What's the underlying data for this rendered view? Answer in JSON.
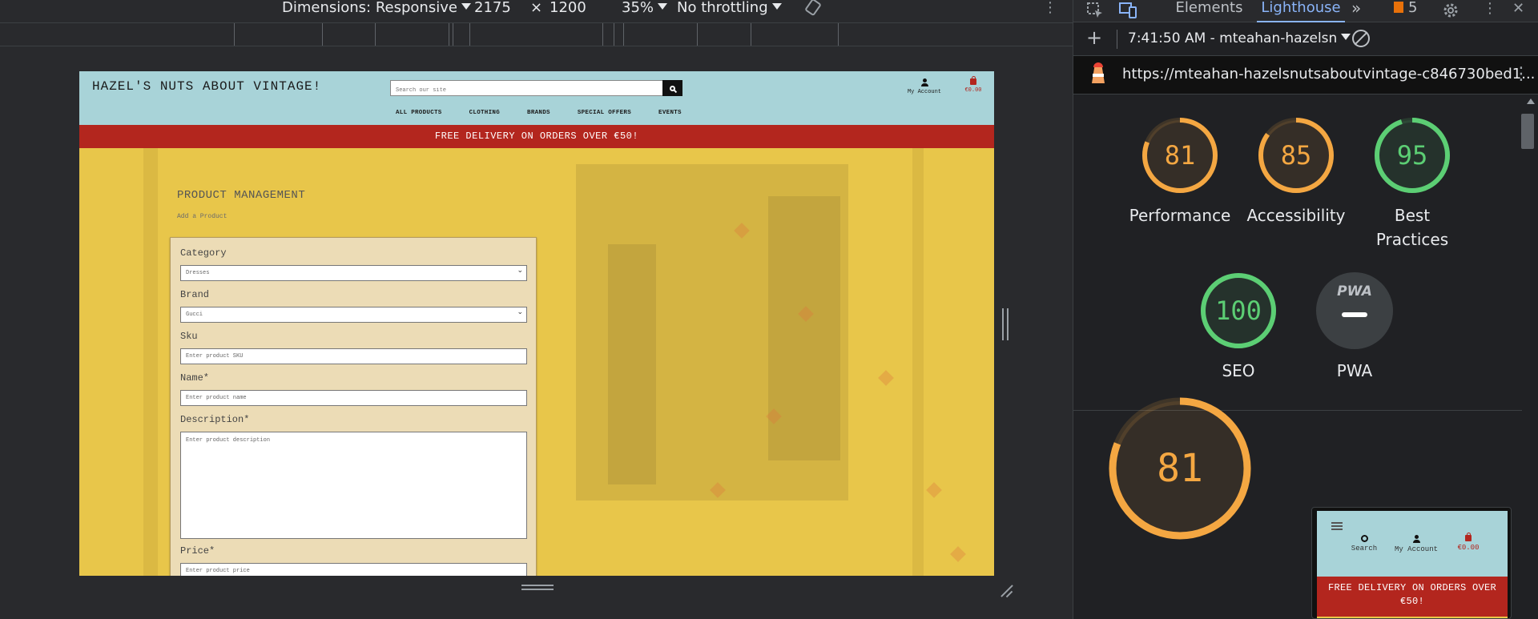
{
  "emulation_toolbar": {
    "dimensions_label": "Dimensions: Responsive",
    "width": "2175",
    "times": "×",
    "height": "1200",
    "zoom": "35%",
    "throttling": "No throttling",
    "more_icon": "⋮"
  },
  "site": {
    "logo": "HAZEL'S NUTS ABOUT VINTAGE!",
    "search_placeholder": "Search our site",
    "account_label": "My Account",
    "bag_total": "€0.00",
    "nav": [
      "ALL PRODUCTS",
      "CLOTHING",
      "BRANDS",
      "SPECIAL OFFERS",
      "EVENTS"
    ],
    "banner": "FREE DELIVERY ON ORDERS OVER €50!",
    "page_title": "PRODUCT MANAGEMENT",
    "page_subtitle": "Add a Product",
    "form": {
      "category_label": "Category",
      "category_value": "Dresses",
      "brand_label": "Brand",
      "brand_value": "Gucci",
      "sku_label": "Sku",
      "sku_placeholder": "Enter product SKU",
      "name_label": "Name*",
      "name_placeholder": "Enter product name",
      "description_label": "Description*",
      "description_placeholder": "Enter product description",
      "price_label": "Price*",
      "price_placeholder": "Enter product price"
    }
  },
  "devtools": {
    "tabs": {
      "elements": "Elements",
      "lighthouse": "Lighthouse",
      "more": "»",
      "issues_count": "5"
    },
    "report_time": "7:41:50 AM - mteahan-hazelsn",
    "url": "https://mteahan-hazelsnutsaboutvintage-c846730bed1...",
    "scores": [
      {
        "label": "Performance",
        "value": "81",
        "fraction": 0.81
      },
      {
        "label": "Accessibility",
        "value": "85",
        "fraction": 0.85
      },
      {
        "label": "Best Practices",
        "value": "95",
        "fraction": 0.95
      },
      {
        "label": "SEO",
        "value": "100",
        "fraction": 1.0
      }
    ],
    "pwa": {
      "label": "PWA",
      "badge": "PWA"
    },
    "performance_big": {
      "value": "81",
      "fraction": 0.81
    },
    "thumbnail": {
      "search": "Search",
      "account": "My Account",
      "bag": "€0.00",
      "banner": "FREE DELIVERY ON ORDERS OVER €50!"
    },
    "colors": {
      "orange": "#f4a742",
      "green": "#5cce74",
      "accent": "#8ab4f8"
    }
  }
}
